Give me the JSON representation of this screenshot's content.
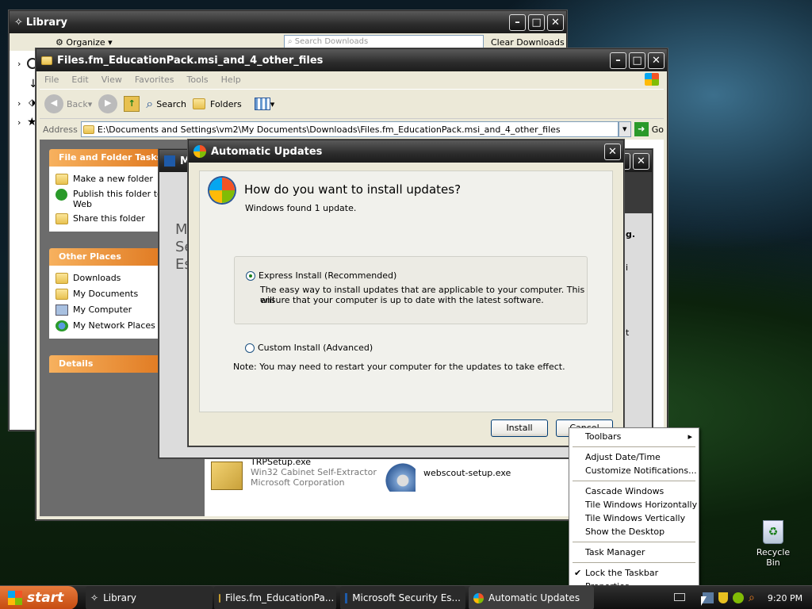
{
  "library": {
    "title": "Library",
    "organize": "Organize",
    "search_placeholder": "Search Downloads",
    "clear": "Clear Downloads"
  },
  "explorer": {
    "title": "Files.fm_EducationPack.msi_and_4_other_files",
    "menu": [
      "File",
      "Edit",
      "View",
      "Favorites",
      "Tools",
      "Help"
    ],
    "toolbar": {
      "back": "Back",
      "search": "Search",
      "folders": "Folders"
    },
    "address_label": "Address",
    "address": "E:\\Documents and Settings\\vm2\\My Documents\\Downloads\\Files.fm_EducationPack.msi_and_4_other_files",
    "go": "Go",
    "tasks": {
      "header": "File and Folder Tasks",
      "items": [
        "Make a new folder",
        "Publish this folder to the Web",
        "Share this folder"
      ]
    },
    "places": {
      "header": "Other Places",
      "items": [
        "Downloads",
        "My Documents",
        "My Computer",
        "My Network Places"
      ]
    },
    "details_header": "Details",
    "files": [
      {
        "name": "TRPSetup.exe",
        "type": "Win32 Cabinet Self-Extractor",
        "company": "Microsoft Corporation"
      },
      {
        "name": "webscout-setup.exe"
      }
    ]
  },
  "mse": {
    "title": "Mi",
    "text_lines": [
      "M",
      "Se",
      "Es"
    ],
    "right_text": [
      "g.",
      "i",
      "t"
    ]
  },
  "updates": {
    "title": "Automatic Updates",
    "heading": "How do you want to install updates?",
    "found": "Windows found 1 update.",
    "express_label": "Express Install (Recommended)",
    "express_desc_1": "The easy way to install updates that are applicable to your computer. This will",
    "express_desc_2": "ensure that your computer is up to date with the latest software.",
    "custom_label": "Custom Install (Advanced)",
    "note": "Note:  You may need to restart your computer for the updates to take effect.",
    "install": "Install",
    "cancel": "Cancel"
  },
  "context_menu": {
    "toolbars": "Toolbars",
    "adjust": "Adjust Date/Time",
    "customize": "Customize Notifications...",
    "cascade": "Cascade Windows",
    "tile_h": "Tile Windows Horizontally",
    "tile_v": "Tile Windows Vertically",
    "show_desktop": "Show the Desktop",
    "task_manager": "Task Manager",
    "lock": "Lock the Taskbar",
    "properties": "Properties"
  },
  "desktop": {
    "recycle_bin": "Recycle Bin"
  },
  "taskbar": {
    "start": "start",
    "items": [
      "Library",
      "Files.fm_EducationPa...",
      "Microsoft Security Es...",
      "Automatic Updates"
    ],
    "clock": "9:20 PM"
  }
}
